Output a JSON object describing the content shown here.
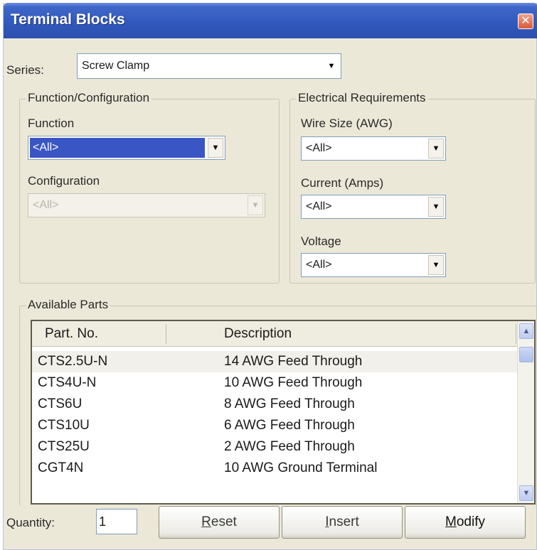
{
  "window": {
    "title": "Terminal Blocks",
    "close_glyph": "✕"
  },
  "series": {
    "label": "Series:",
    "value": "Screw Clamp"
  },
  "function_config": {
    "title": "Function/Configuration",
    "function_label": "Function",
    "function_value": "<All>",
    "configuration_label": "Configuration",
    "configuration_value": "<All>"
  },
  "electrical": {
    "title": "Electrical Requirements",
    "wire_label": "Wire Size (AWG)",
    "wire_value": "<All>",
    "current_label": "Current (Amps)",
    "current_value": "<All>",
    "voltage_label": "Voltage",
    "voltage_value": "<All>"
  },
  "parts": {
    "title": "Available Parts",
    "columns": [
      "Part. No.",
      "Description"
    ],
    "rows": [
      {
        "part": "CTS2.5U-N",
        "desc": "14 AWG Feed Through"
      },
      {
        "part": "CTS4U-N",
        "desc": "10 AWG Feed Through"
      },
      {
        "part": "CTS6U",
        "desc": "8 AWG Feed Through"
      },
      {
        "part": "CTS10U",
        "desc": "6 AWG Feed Through"
      },
      {
        "part": "CTS25U",
        "desc": "2 AWG Feed Through"
      },
      {
        "part": "CGT4N",
        "desc": "10 AWG Ground Terminal"
      }
    ]
  },
  "footer": {
    "quantity_label": "Quantity:",
    "quantity_value": "1",
    "reset_first": "R",
    "reset_rest": "eset",
    "insert_first": "I",
    "insert_rest": "nsert",
    "modify_first": "M",
    "modify_rest": "odify"
  },
  "icons": {
    "dropdown": "chevron-down-icon",
    "close": "close-icon",
    "scroll_up": "scroll-up-arrow-icon",
    "scroll_down": "scroll-down-arrow-icon"
  },
  "colors": {
    "title_bar": "#3259bd",
    "selection": "#3a56c4",
    "dialog_bg": "#ece8d8"
  }
}
